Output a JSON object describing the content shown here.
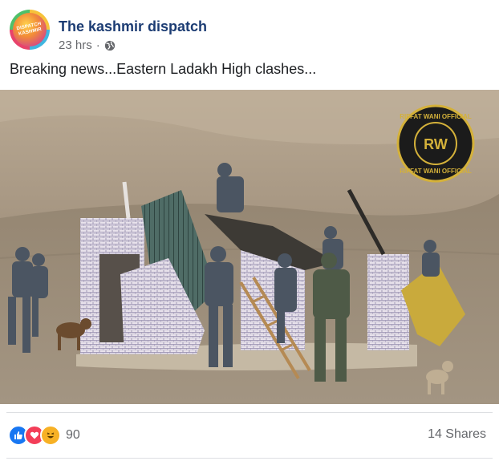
{
  "post": {
    "page_name": "The kashmir dispatch",
    "avatar_text": "DISPATCH KASHMIR",
    "time": "23 hrs",
    "separator": "·",
    "privacy_icon": "globe-icon",
    "text": "Breaking news...Eastern Ladakh High clashes...",
    "photo": {
      "watermark_top": "RIFFAT WANI OFFICIAL",
      "watermark_bottom": "RIFFAT WANI OFFICIAL",
      "watermark_logo": "RW"
    },
    "reactions": {
      "icons": [
        "like-icon",
        "love-icon",
        "haha-icon"
      ],
      "count": "90"
    },
    "shares": "14 Shares"
  }
}
